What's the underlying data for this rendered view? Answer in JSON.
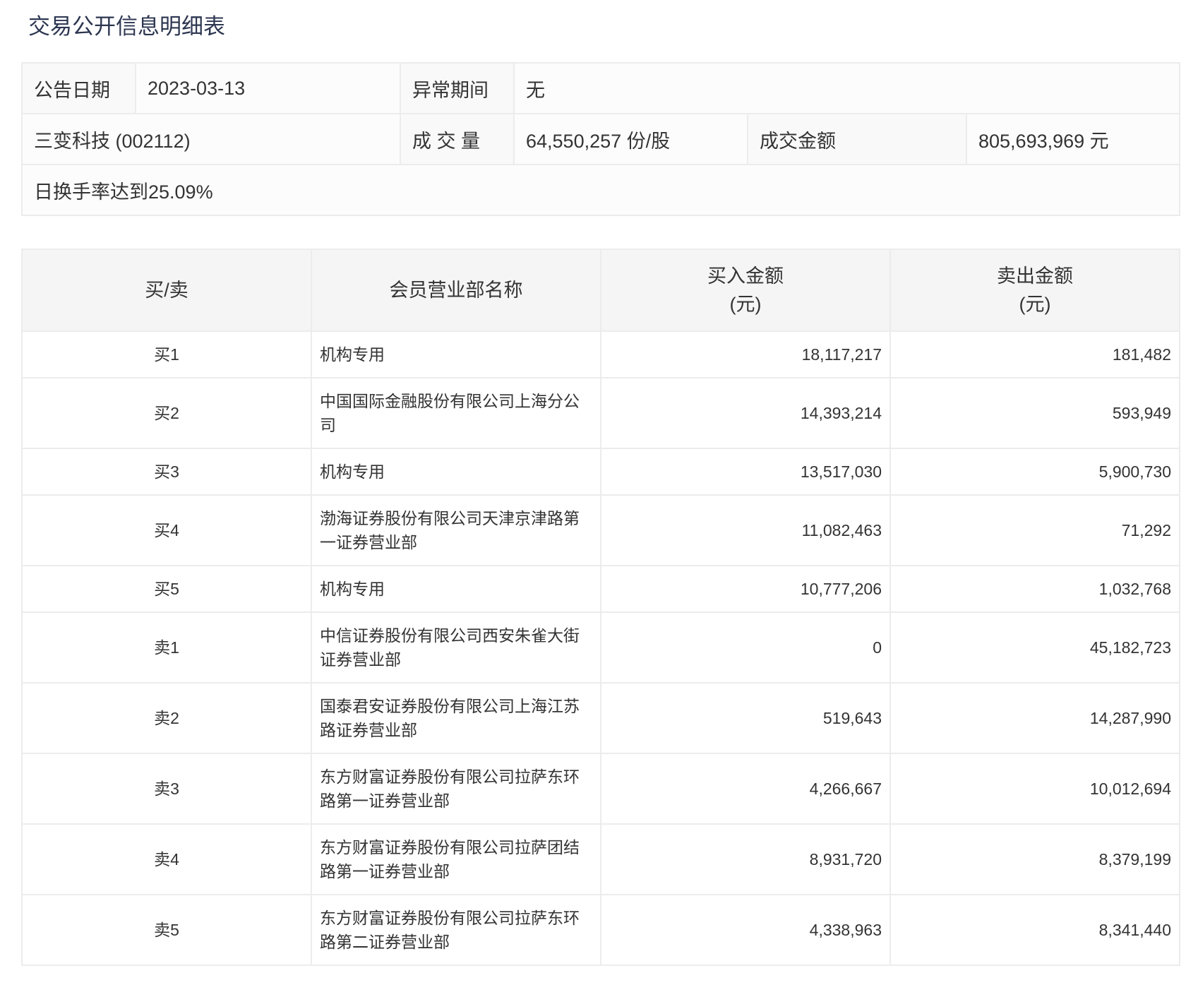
{
  "title": "交易公开信息明细表",
  "info": {
    "date_label": "公告日期",
    "date_value": "2023-03-13",
    "period_label": "异常期间",
    "period_value": "无",
    "stock": "三变科技 (002112)",
    "volume_label": "成 交 量",
    "volume_value": "64,550,257 份/股",
    "amount_label": "成交金额",
    "amount_value": "805,693,969 元",
    "reason": "日换手率达到25.09%"
  },
  "table": {
    "headers": {
      "side": "买/卖",
      "name": "会员营业部名称",
      "buy": "买入金额",
      "buy_unit": "(元)",
      "sell": "卖出金额",
      "sell_unit": "(元)"
    },
    "rows": [
      {
        "side": "买1",
        "name": "机构专用",
        "buy": "18,117,217",
        "sell": "181,482"
      },
      {
        "side": "买2",
        "name": "中国国际金融股份有限公司上海分公司",
        "buy": "14,393,214",
        "sell": "593,949"
      },
      {
        "side": "买3",
        "name": "机构专用",
        "buy": "13,517,030",
        "sell": "5,900,730"
      },
      {
        "side": "买4",
        "name": "渤海证券股份有限公司天津京津路第一证券营业部",
        "buy": "11,082,463",
        "sell": "71,292"
      },
      {
        "side": "买5",
        "name": "机构专用",
        "buy": "10,777,206",
        "sell": "1,032,768"
      },
      {
        "side": "卖1",
        "name": "中信证券股份有限公司西安朱雀大街证券营业部",
        "buy": "0",
        "sell": "45,182,723"
      },
      {
        "side": "卖2",
        "name": "国泰君安证券股份有限公司上海江苏路证券营业部",
        "buy": "519,643",
        "sell": "14,287,990"
      },
      {
        "side": "卖3",
        "name": "东方财富证券股份有限公司拉萨东环路第一证券营业部",
        "buy": "4,266,667",
        "sell": "10,012,694"
      },
      {
        "side": "卖4",
        "name": "东方财富证券股份有限公司拉萨团结路第一证券营业部",
        "buy": "8,931,720",
        "sell": "8,379,199"
      },
      {
        "side": "卖5",
        "name": "东方财富证券股份有限公司拉萨东环路第二证券营业部",
        "buy": "4,338,963",
        "sell": "8,341,440"
      }
    ]
  }
}
